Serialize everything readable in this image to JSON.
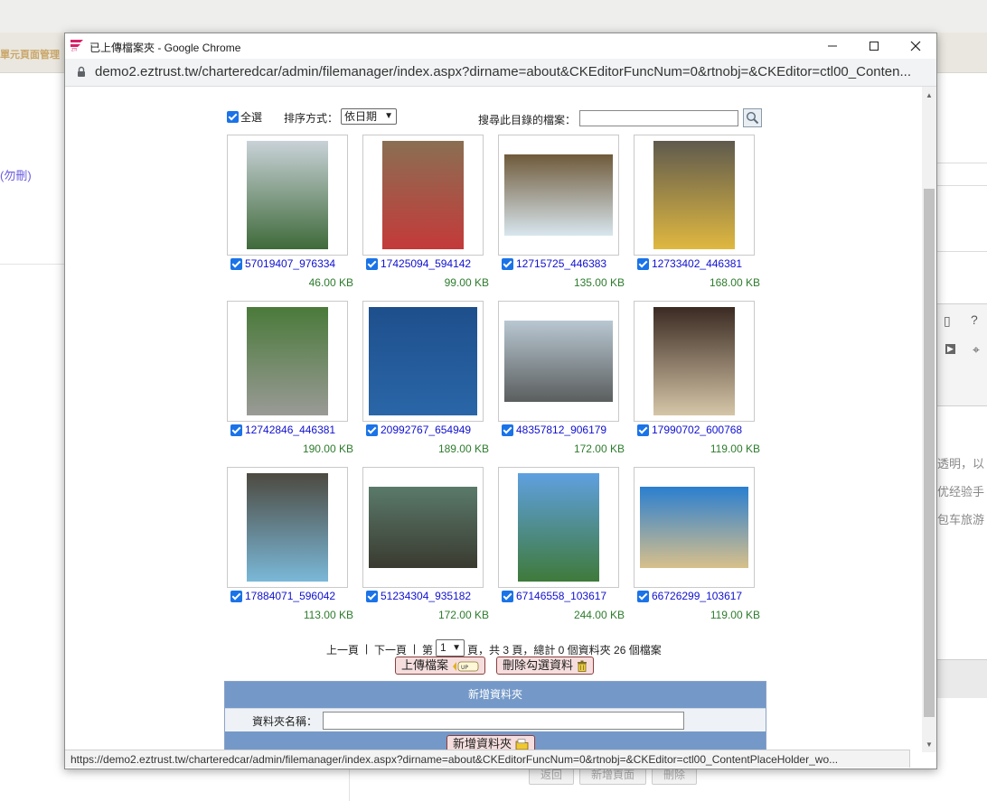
{
  "background": {
    "title_fragment": "單元頁面管理",
    "delete_note": "(勿刪)",
    "text_lines": [
      "透明，以",
      "优经验手",
      "包车旅游"
    ],
    "bottom_buttons": [
      "返回",
      "新增頁面",
      "刪除"
    ]
  },
  "window": {
    "title": "已上傳檔案夾 - Google Chrome",
    "url": "demo2.eztrust.tw/charteredcar/admin/filemanager/index.aspx?dirname=about&CKEditorFuncNum=0&rtnobj=&CKEditor=ctl00_Conten...",
    "status_url": "https://demo2.eztrust.tw/charteredcar/admin/filemanager/index.aspx?dirname=about&CKEditorFuncNum=0&rtnobj=&CKEditor=ctl00_ContentPlaceHolder_wo..."
  },
  "toolbar": {
    "select_all": "全選",
    "sort_label": "排序方式：",
    "sort_value": "依日期",
    "search_label": "搜尋此目錄的檔案："
  },
  "files": [
    {
      "name": "57019407_976334",
      "size": "46.00 KB",
      "shape": "portrait",
      "c1": "#c9d2d8",
      "c2": "#3f6a3a"
    },
    {
      "name": "17425094_594142",
      "size": "99.00 KB",
      "shape": "portrait",
      "c1": "#8a6f52",
      "c2": "#c43a3a"
    },
    {
      "name": "12715725_446383",
      "size": "135.00 KB",
      "shape": "landscape",
      "c1": "#6f5a3a",
      "c2": "#d8e6ee"
    },
    {
      "name": "12733402_446381",
      "size": "168.00 KB",
      "shape": "portrait",
      "c1": "#5f5a4e",
      "c2": "#e0b840"
    },
    {
      "name": "12742846_446381",
      "size": "190.00 KB",
      "shape": "portrait",
      "c1": "#4a7a3a",
      "c2": "#9a9a96"
    },
    {
      "name": "20992767_654949",
      "size": "189.00 KB",
      "shape": "square",
      "c1": "#1e4f8c",
      "c2": "#2a66a8"
    },
    {
      "name": "48357812_906179",
      "size": "172.00 KB",
      "shape": "landscape",
      "c1": "#b9c7d2",
      "c2": "#5a5e5e"
    },
    {
      "name": "17990702_600768",
      "size": "119.00 KB",
      "shape": "portrait",
      "c1": "#3a2a22",
      "c2": "#d6c6a8"
    },
    {
      "name": "17884071_596042",
      "size": "113.00 KB",
      "shape": "portrait",
      "c1": "#4d4a40",
      "c2": "#7ab8d8"
    },
    {
      "name": "51234304_935182",
      "size": "172.00 KB",
      "shape": "landscape",
      "c1": "#5a7a6a",
      "c2": "#3a3a30"
    },
    {
      "name": "67146558_103617",
      "size": "244.00 KB",
      "shape": "portrait",
      "c1": "#5fa0e0",
      "c2": "#3f7a3a"
    },
    {
      "name": "66726299_103617",
      "size": "119.00 KB",
      "shape": "landscape",
      "c1": "#2a7fd0",
      "c2": "#d8c08a"
    }
  ],
  "pager": {
    "prev": "上一頁",
    "sep": "|",
    "next": "下一頁",
    "page_prefix": "第",
    "page_value": "1",
    "page_suffix": "頁，共 3 頁，總計 0 個資料夾 26 個檔案"
  },
  "actions": {
    "upload": "上傳檔案",
    "delete_checked": "刪除勾選資料"
  },
  "folder": {
    "header": "新增資料夾",
    "name_label": "資料夾名稱：",
    "create_button": "新增資料夾"
  }
}
